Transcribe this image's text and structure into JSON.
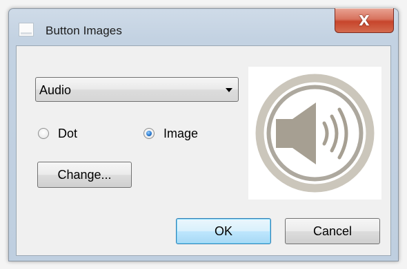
{
  "window": {
    "title": "Button Images",
    "close_glyph": "X"
  },
  "dropdown": {
    "selected": "Audio"
  },
  "radios": {
    "dot_label": "Dot",
    "image_label": "Image",
    "selected": "Image"
  },
  "buttons": {
    "change_label": "Change...",
    "ok_label": "OK",
    "cancel_label": "Cancel"
  },
  "preview": {
    "icon": "speaker-volume-icon",
    "ring_color": "#cbc6bb",
    "ring_inner_color": "#ada89e",
    "speaker_color": "#a69f92"
  },
  "colors": {
    "titlebar": "#c3d2e2",
    "close_button": "#c7452c",
    "dialog_background": "#f0f0f0",
    "default_button": "#bee6fd"
  }
}
